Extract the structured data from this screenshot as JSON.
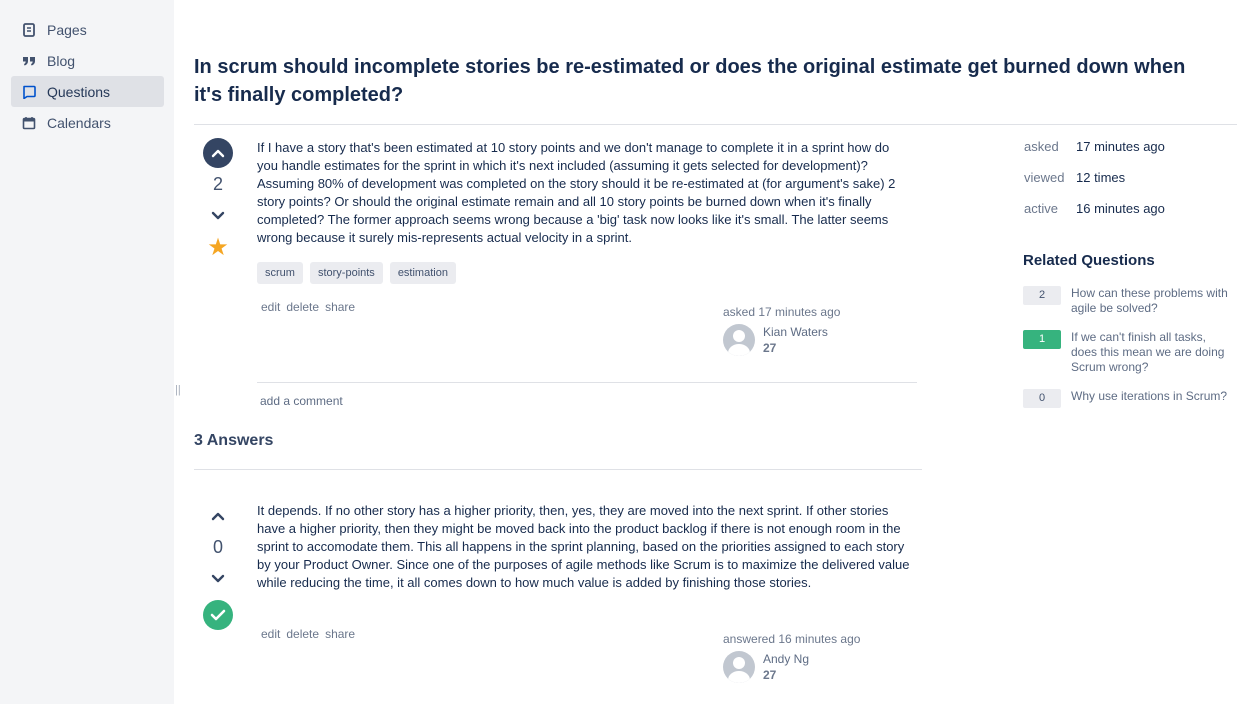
{
  "sidebar": {
    "items": [
      {
        "label": "Pages",
        "icon": "page-icon"
      },
      {
        "label": "Blog",
        "icon": "quote-icon"
      },
      {
        "label": "Questions",
        "icon": "question-bubble-icon",
        "active": true
      },
      {
        "label": "Calendars",
        "icon": "calendar-icon"
      }
    ]
  },
  "question": {
    "title": "In scrum should incomplete stories be re-estimated or does the original estimate get burned down when it's finally completed?",
    "votes": "2",
    "body": "If I have a story that's been estimated at 10 story points and we don't manage to complete it in a sprint how do you handle estimates for the sprint in which it's next included (assuming it gets selected for development)? Assuming 80% of development was completed on the story should it be re-estimated at (for argument's sake) 2 story points? Or should the original estimate remain and all 10 story points be burned down when it's finally completed? The former approach seems wrong because a 'big' task now looks like it's small. The latter seems wrong because it surely mis-represents actual velocity in a sprint.",
    "tags": [
      "scrum",
      "story-points",
      "estimation"
    ],
    "actions": {
      "edit": "edit",
      "delete": "delete",
      "share": "share"
    },
    "signature": {
      "label": "asked 17 minutes ago",
      "user": "Kian Waters",
      "reputation": "27"
    },
    "add_comment": "add a comment"
  },
  "answers": {
    "heading": "3 Answers",
    "items": [
      {
        "votes": "0",
        "accepted": true,
        "body": "It depends. If no other story has a higher priority, then, yes, they are moved into the next sprint. If other stories have a higher priority, then they might be moved back into the product backlog if there is not enough room in the sprint to accomodate them. This all happens in the sprint planning, based on the priorities assigned to each story by your Product Owner. Since one of the purposes of agile methods like Scrum is to maximize the delivered value while reducing the time, it all comes down to how much value is added by finishing those stories.",
        "actions": {
          "edit": "edit",
          "delete": "delete",
          "share": "share"
        },
        "signature": {
          "label": "answered 16 minutes ago",
          "user": "Andy Ng",
          "reputation": "27"
        }
      }
    ]
  },
  "meta": {
    "asked_label": "asked",
    "asked_value": "17 minutes ago",
    "viewed_label": "viewed",
    "viewed_value": "12 times",
    "active_label": "active",
    "active_value": "16 minutes ago"
  },
  "related": {
    "title": "Related Questions",
    "items": [
      {
        "count": "2",
        "text": "How can these problems with agile be solved?",
        "highlight": false
      },
      {
        "count": "1",
        "text": "If we can't finish all tasks, does this mean we are doing Scrum wrong?",
        "highlight": true
      },
      {
        "count": "0",
        "text": "Why use iterations in Scrum?",
        "highlight": false
      }
    ]
  },
  "colors": {
    "accent": "#0052cc",
    "accepted": "#36b37e",
    "star": "#f5a623",
    "vote_button": "#344563"
  }
}
